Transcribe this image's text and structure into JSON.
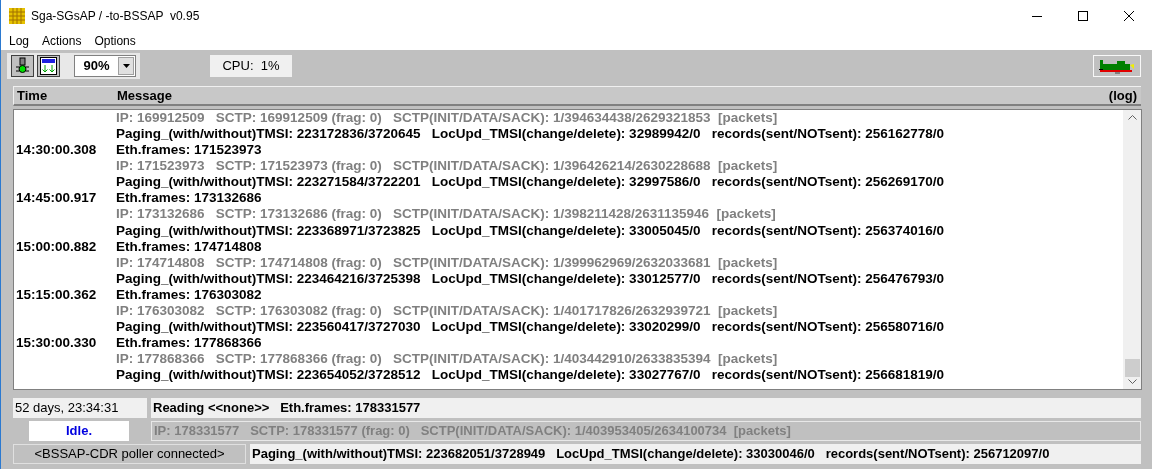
{
  "window": {
    "title": "Sga-SGsAP / -to-BSSAP  v0.95"
  },
  "menu": [
    "Log",
    "Actions",
    "Options"
  ],
  "toolbar": {
    "zoom": "90%",
    "cpu": "CPU:  1%"
  },
  "log": {
    "columns": [
      "Time",
      "Message",
      "(log)"
    ],
    "rows": [
      {
        "kind": "ip",
        "message": "IP: 169912509   SCTP: 169912509 (frag: 0)   SCTP(INIT/DATA/SACK): 1/394634438/2629321853  [packets]"
      },
      {
        "kind": "paging",
        "message": "Paging_(with/without)TMSI: 223172836/3720645   LocUpd_TMSI(change/delete): 32989942/0   records(sent/NOTsent): 256162778/0"
      },
      {
        "kind": "eth",
        "time": "14:30:00.308",
        "message": "Eth.frames: 171523973"
      },
      {
        "kind": "ip",
        "message": "IP: 171523973   SCTP: 171523973 (frag: 0)   SCTP(INIT/DATA/SACK): 1/396426214/2630228688  [packets]"
      },
      {
        "kind": "paging",
        "message": "Paging_(with/without)TMSI: 223271584/3722201   LocUpd_TMSI(change/delete): 32997586/0   records(sent/NOTsent): 256269170/0"
      },
      {
        "kind": "eth",
        "time": "14:45:00.917",
        "message": "Eth.frames: 173132686"
      },
      {
        "kind": "ip",
        "message": "IP: 173132686   SCTP: 173132686 (frag: 0)   SCTP(INIT/DATA/SACK): 1/398211428/2631135946  [packets]"
      },
      {
        "kind": "paging",
        "message": "Paging_(with/without)TMSI: 223368971/3723825   LocUpd_TMSI(change/delete): 33005045/0   records(sent/NOTsent): 256374016/0"
      },
      {
        "kind": "eth",
        "time": "15:00:00.882",
        "message": "Eth.frames: 174714808"
      },
      {
        "kind": "ip",
        "message": "IP: 174714808   SCTP: 174714808 (frag: 0)   SCTP(INIT/DATA/SACK): 1/399962969/2632033681  [packets]"
      },
      {
        "kind": "paging",
        "message": "Paging_(with/without)TMSI: 223464216/3725398   LocUpd_TMSI(change/delete): 33012577/0   records(sent/NOTsent): 256476793/0"
      },
      {
        "kind": "eth",
        "time": "15:15:00.362",
        "message": "Eth.frames: 176303082"
      },
      {
        "kind": "ip",
        "message": "IP: 176303082   SCTP: 176303082 (frag: 0)   SCTP(INIT/DATA/SACK): 1/401717826/2632939721  [packets]"
      },
      {
        "kind": "paging",
        "message": "Paging_(with/without)TMSI: 223560417/3727030   LocUpd_TMSI(change/delete): 33020299/0   records(sent/NOTsent): 256580716/0"
      },
      {
        "kind": "eth",
        "time": "15:30:00.330",
        "message": "Eth.frames: 177868366"
      },
      {
        "kind": "ip",
        "message": "IP: 177868366   SCTP: 177868366 (frag: 0)   SCTP(INIT/DATA/SACK): 1/403442910/2633835394  [packets]"
      },
      {
        "kind": "paging",
        "message": "Paging_(with/without)TMSI: 223654052/3728512   LocUpd_TMSI(change/delete): 33027767/0   records(sent/NOTsent): 256681819/0"
      }
    ]
  },
  "status": {
    "uptime": "52 days, 23:34:31",
    "state": "Idle.",
    "poller": "<BSSAP-CDR poller connected>",
    "lines": [
      {
        "kind": "eth",
        "text": "Reading <<none>>   Eth.frames: 178331577"
      },
      {
        "kind": "ip",
        "text": "IP: 178331577   SCTP: 178331577 (frag: 0)   SCTP(INIT/DATA/SACK): 1/403953405/2634100734  [packets]"
      },
      {
        "kind": "paging",
        "text": "Paging_(with/without)TMSI: 223682051/3728949   LocUpd_TMSI(change/delete): 33030046/0   records(sent/NOTsent): 256712097/0"
      }
    ]
  }
}
